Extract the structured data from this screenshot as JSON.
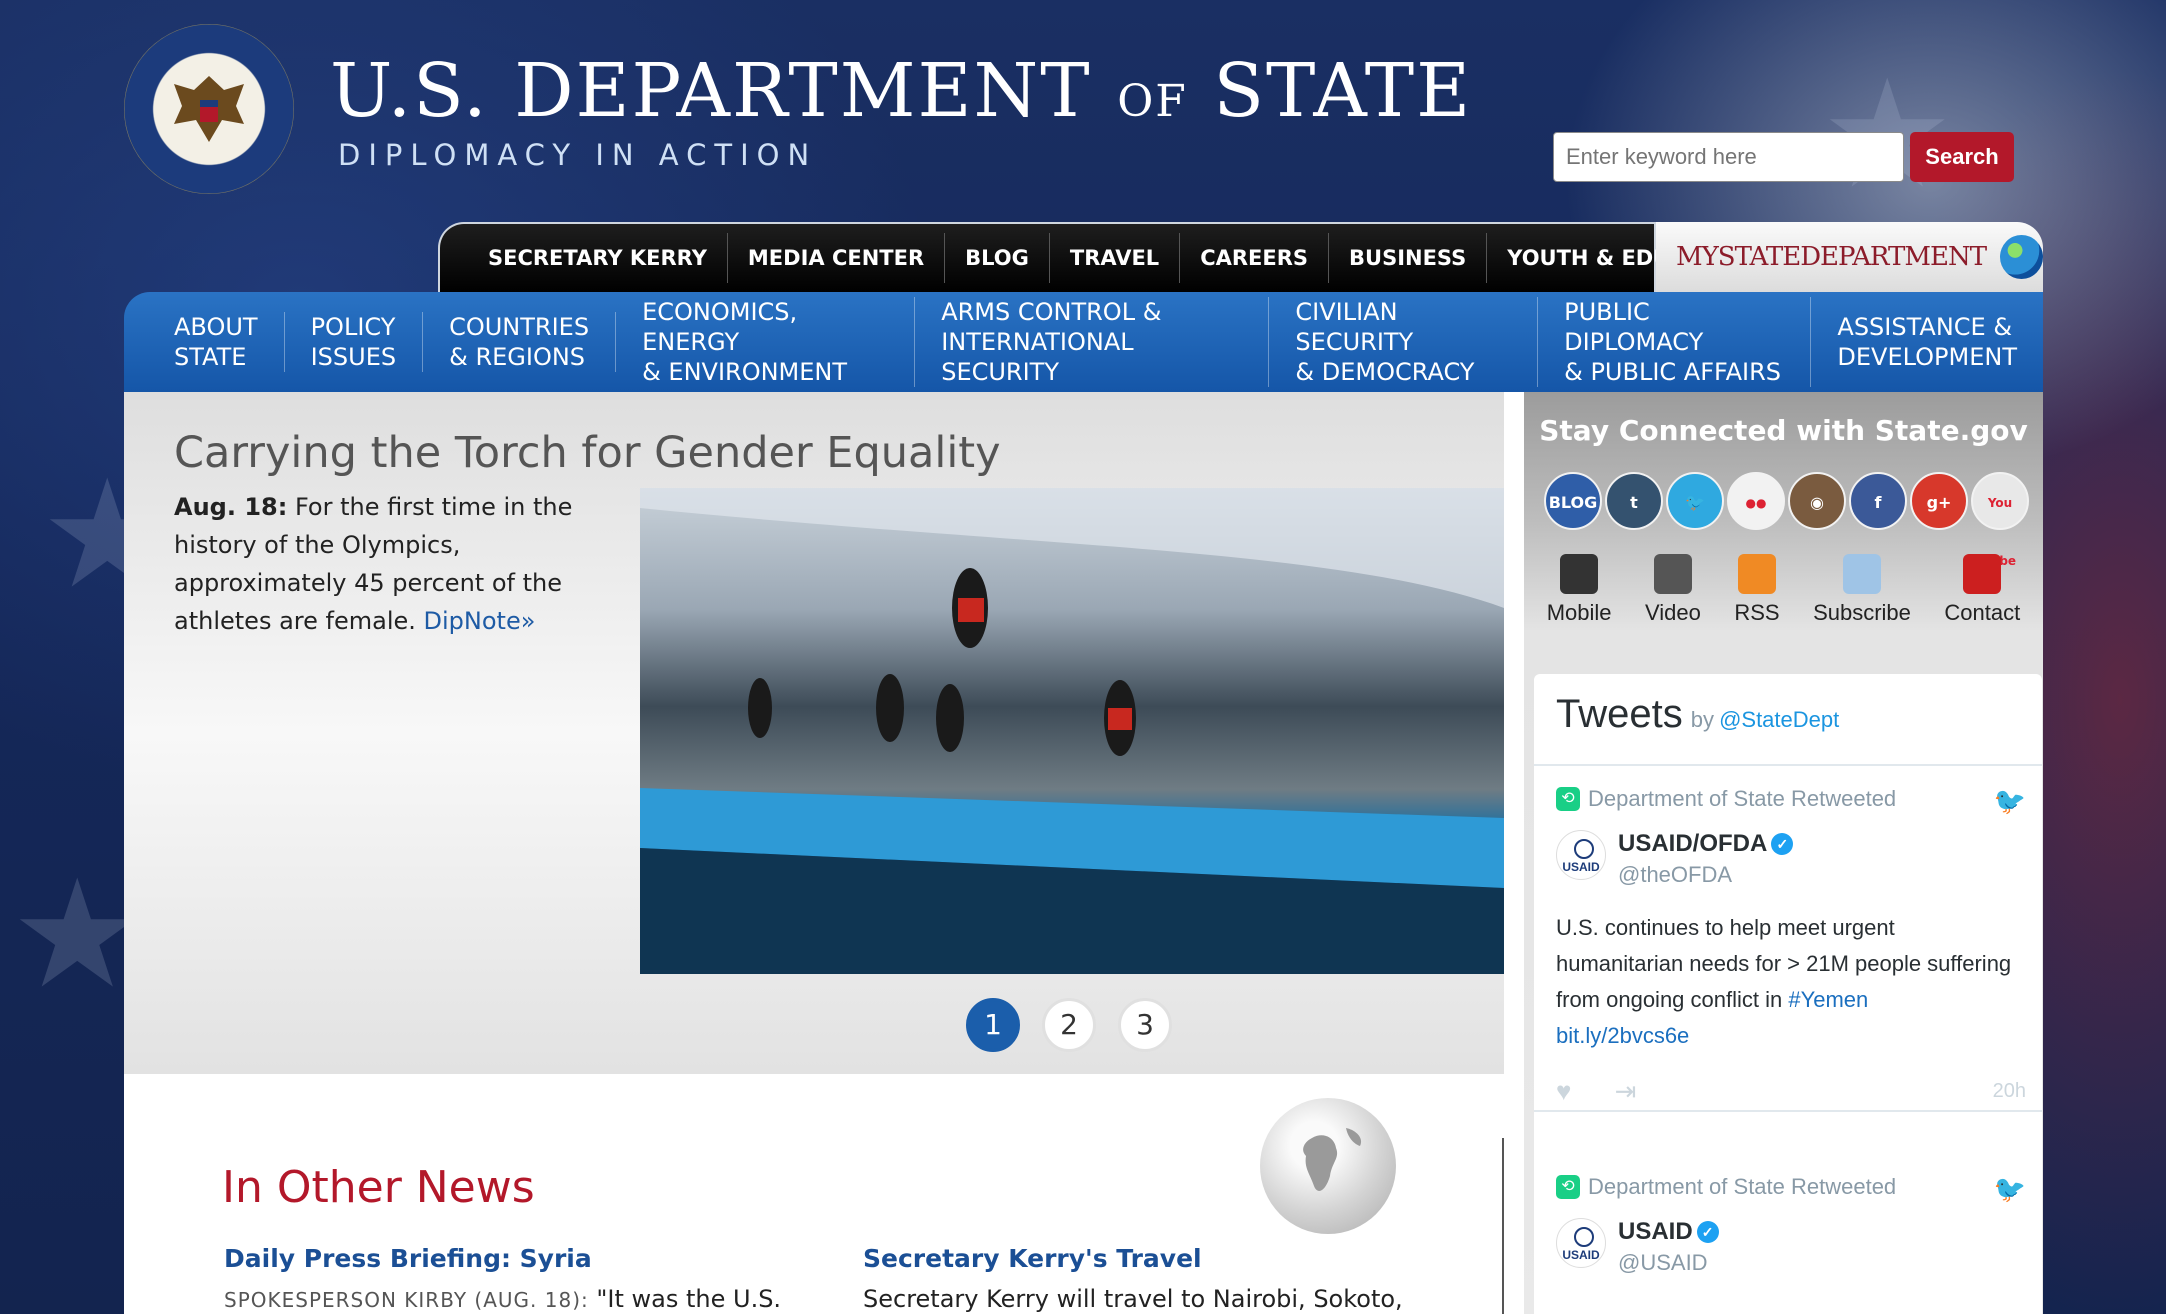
{
  "header": {
    "title_main_1": "U.S. DEPARTMENT ",
    "title_of": "OF",
    "title_main_2": " STATE",
    "tagline": "DIPLOMACY IN ACTION",
    "search_placeholder": "Enter keyword here",
    "search_button": "Search"
  },
  "topnav": {
    "items": [
      "SECRETARY KERRY",
      "MEDIA CENTER",
      "BLOG",
      "TRAVEL",
      "CAREERS",
      "BUSINESS",
      "YOUTH & EDUCATION"
    ],
    "mystate": "MYSTATEDEPARTMENT"
  },
  "bluenav": {
    "items": [
      "ABOUT\nSTATE",
      "POLICY\nISSUES",
      "COUNTRIES\n& REGIONS",
      "ECONOMICS, ENERGY\n& ENVIRONMENT",
      "ARMS CONTROL &\nINTERNATIONAL SECURITY",
      "CIVILIAN SECURITY\n& DEMOCRACY",
      "PUBLIC DIPLOMACY\n& PUBLIC AFFAIRS",
      "ASSISTANCE &\nDEVELOPMENT"
    ]
  },
  "hero": {
    "title": "Carrying the Torch for Gender Equality",
    "date": "Aug. 18:",
    "text": " For the first time in the history of the Olympics, approximately 45 percent of the athletes are female. ",
    "link": "DipNote»",
    "slides": [
      "1",
      "2",
      "3"
    ],
    "active_slide": 1
  },
  "news": {
    "title": "In Other News",
    "col1_head": "Daily Press Briefing: Syria",
    "col1_meta": "SPOKESPERSON KIRBY (AUG. 18):",
    "col1_text": " \"It was the U.S.",
    "col2_head": "Secretary Kerry's Travel",
    "col2_text": "Secretary Kerry will travel to Nairobi, Sokoto,"
  },
  "sidebar": {
    "title": "Stay Connected with State.gov",
    "social": [
      {
        "label": "BLOG",
        "icon": "blog-icon",
        "color": "#2f5ea8"
      },
      {
        "label": "t",
        "icon": "tumblr-icon",
        "color": "#34526f"
      },
      {
        "label": "🐦",
        "icon": "twitter-icon",
        "color": "#2fa9e0"
      },
      {
        "label": "●●",
        "icon": "flickr-icon",
        "color": "#f2f2f2"
      },
      {
        "label": "◉",
        "icon": "instagram-icon",
        "color": "#7a5b3f"
      },
      {
        "label": "f",
        "icon": "facebook-icon",
        "color": "#3b5998"
      },
      {
        "label": "g+",
        "icon": "googleplus-icon",
        "color": "#d7382b"
      },
      {
        "label": "You Tube",
        "icon": "youtube-icon",
        "color": "#e8e8e8"
      }
    ],
    "utilities": [
      {
        "label": "Mobile",
        "icon": "mobile-icon",
        "color": "#333333"
      },
      {
        "label": "Video",
        "icon": "video-icon",
        "color": "#555555"
      },
      {
        "label": "RSS",
        "icon": "rss-icon",
        "color": "#f08a24"
      },
      {
        "label": "Subscribe",
        "icon": "envelope-icon",
        "color": "#9fc4e6"
      },
      {
        "label": "Contact",
        "icon": "at-icon",
        "color": "#cc1f1f"
      }
    ],
    "tweets": {
      "title": "Tweets",
      "by": "by",
      "handle": "@StateDept",
      "items": [
        {
          "retweeted": "Department of State Retweeted",
          "author": "USAID/OFDA",
          "author_handle": "@theOFDA",
          "avatar": "USAID",
          "body": "U.S. continues to help meet urgent humanitarian needs for > 21M people suffering from ongoing conflict in ",
          "hashtag": "#Yemen",
          "link": "bit.ly/2bvcs6e",
          "time": "20h"
        },
        {
          "retweeted": "Department of State Retweeted",
          "author": "USAID",
          "author_handle": "@USAID",
          "avatar": "USAID"
        }
      ]
    }
  }
}
